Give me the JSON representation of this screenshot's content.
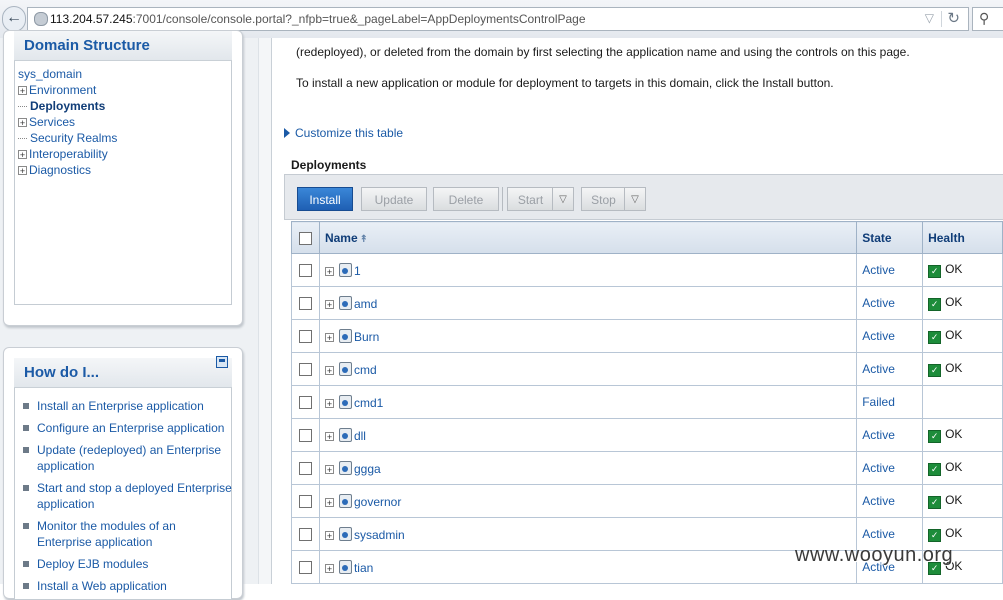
{
  "browser": {
    "url_host": "113.204.57.245",
    "url_rest": ":7001/console/console.portal?_nfpb=true&_pageLabel=AppDeploymentsControlPage"
  },
  "domain_structure": {
    "title": "Domain Structure",
    "root": "sys_domain",
    "items": [
      "Environment",
      "Deployments",
      "Services",
      "Security Realms",
      "Interoperability",
      "Diagnostics"
    ]
  },
  "how_do_i": {
    "title": "How do I...",
    "links": [
      "Install an Enterprise application",
      "Configure an Enterprise application",
      "Update (redeployed) an Enterprise application",
      "Start and stop a deployed Enterprise application",
      "Monitor the modules of an Enterprise application",
      "Deploy EJB modules",
      "Install a Web application"
    ]
  },
  "main": {
    "intro_line1": "(redeployed), or deleted from the domain by first selecting the application name and using the controls on this page.",
    "intro_line2": "To install a new application or module for deployment to targets in this domain, click the Install button.",
    "customize": "Customize this table",
    "section_title": "Deployments"
  },
  "toolbar": {
    "install": "Install",
    "update": "Update",
    "delete": "Delete",
    "start": "Start",
    "stop": "Stop"
  },
  "table": {
    "headers": {
      "name": "Name",
      "state": "State",
      "health": "Health"
    },
    "rows": [
      {
        "name": "1",
        "state": "Active",
        "health": "OK"
      },
      {
        "name": "amd",
        "state": "Active",
        "health": "OK"
      },
      {
        "name": "Burn",
        "state": "Active",
        "health": "OK"
      },
      {
        "name": "cmd",
        "state": "Active",
        "health": "OK"
      },
      {
        "name": "cmd1",
        "state": "Failed",
        "health": ""
      },
      {
        "name": "dll",
        "state": "Active",
        "health": "OK"
      },
      {
        "name": "ggga",
        "state": "Active",
        "health": "OK"
      },
      {
        "name": "governor",
        "state": "Active",
        "health": "OK"
      },
      {
        "name": "sysadmin",
        "state": "Active",
        "health": "OK"
      },
      {
        "name": "tian",
        "state": "Active",
        "health": "OK"
      }
    ]
  },
  "watermark": "www.wooyun.org"
}
